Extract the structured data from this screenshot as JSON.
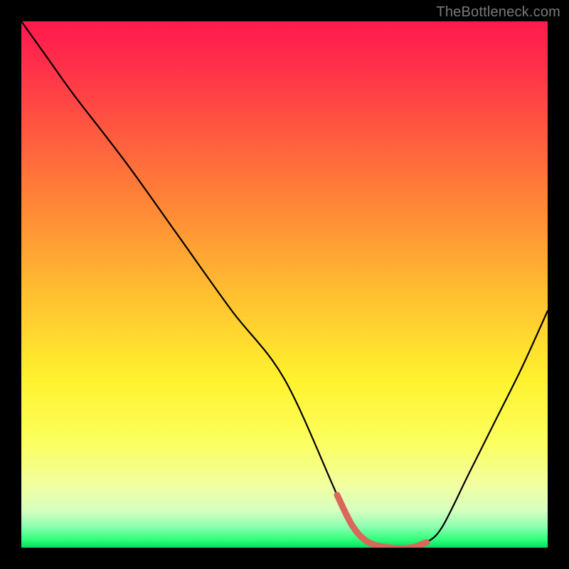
{
  "watermark": "TheBottleneck.com",
  "chart_data": {
    "type": "line",
    "title": "",
    "xlabel": "",
    "ylabel": "",
    "ylim": [
      0,
      100
    ],
    "xlim": [
      0,
      100
    ],
    "x": [
      0,
      5,
      10,
      20,
      30,
      40,
      50,
      60,
      63,
      66,
      70,
      74,
      77,
      80,
      85,
      90,
      95,
      100
    ],
    "values": [
      100,
      93,
      86,
      73,
      59,
      45,
      32,
      10,
      4,
      1,
      0,
      0,
      1,
      4,
      14,
      24,
      34,
      45
    ],
    "highlight_segment": {
      "start_index": 7,
      "end_index": 12,
      "color": "#d9675b"
    },
    "background_gradient_stops": [
      {
        "pos": 0,
        "color": "#ff1a4d"
      },
      {
        "pos": 0.08,
        "color": "#ff2e4a"
      },
      {
        "pos": 0.2,
        "color": "#ff5640"
      },
      {
        "pos": 0.36,
        "color": "#ff8a36"
      },
      {
        "pos": 0.52,
        "color": "#ffc030"
      },
      {
        "pos": 0.68,
        "color": "#fff22e"
      },
      {
        "pos": 0.8,
        "color": "#fcff5e"
      },
      {
        "pos": 0.88,
        "color": "#f2ffa0"
      },
      {
        "pos": 0.93,
        "color": "#d6ffc0"
      },
      {
        "pos": 0.96,
        "color": "#8cffb0"
      },
      {
        "pos": 0.985,
        "color": "#2eff7a"
      },
      {
        "pos": 1.0,
        "color": "#00e060"
      }
    ]
  }
}
